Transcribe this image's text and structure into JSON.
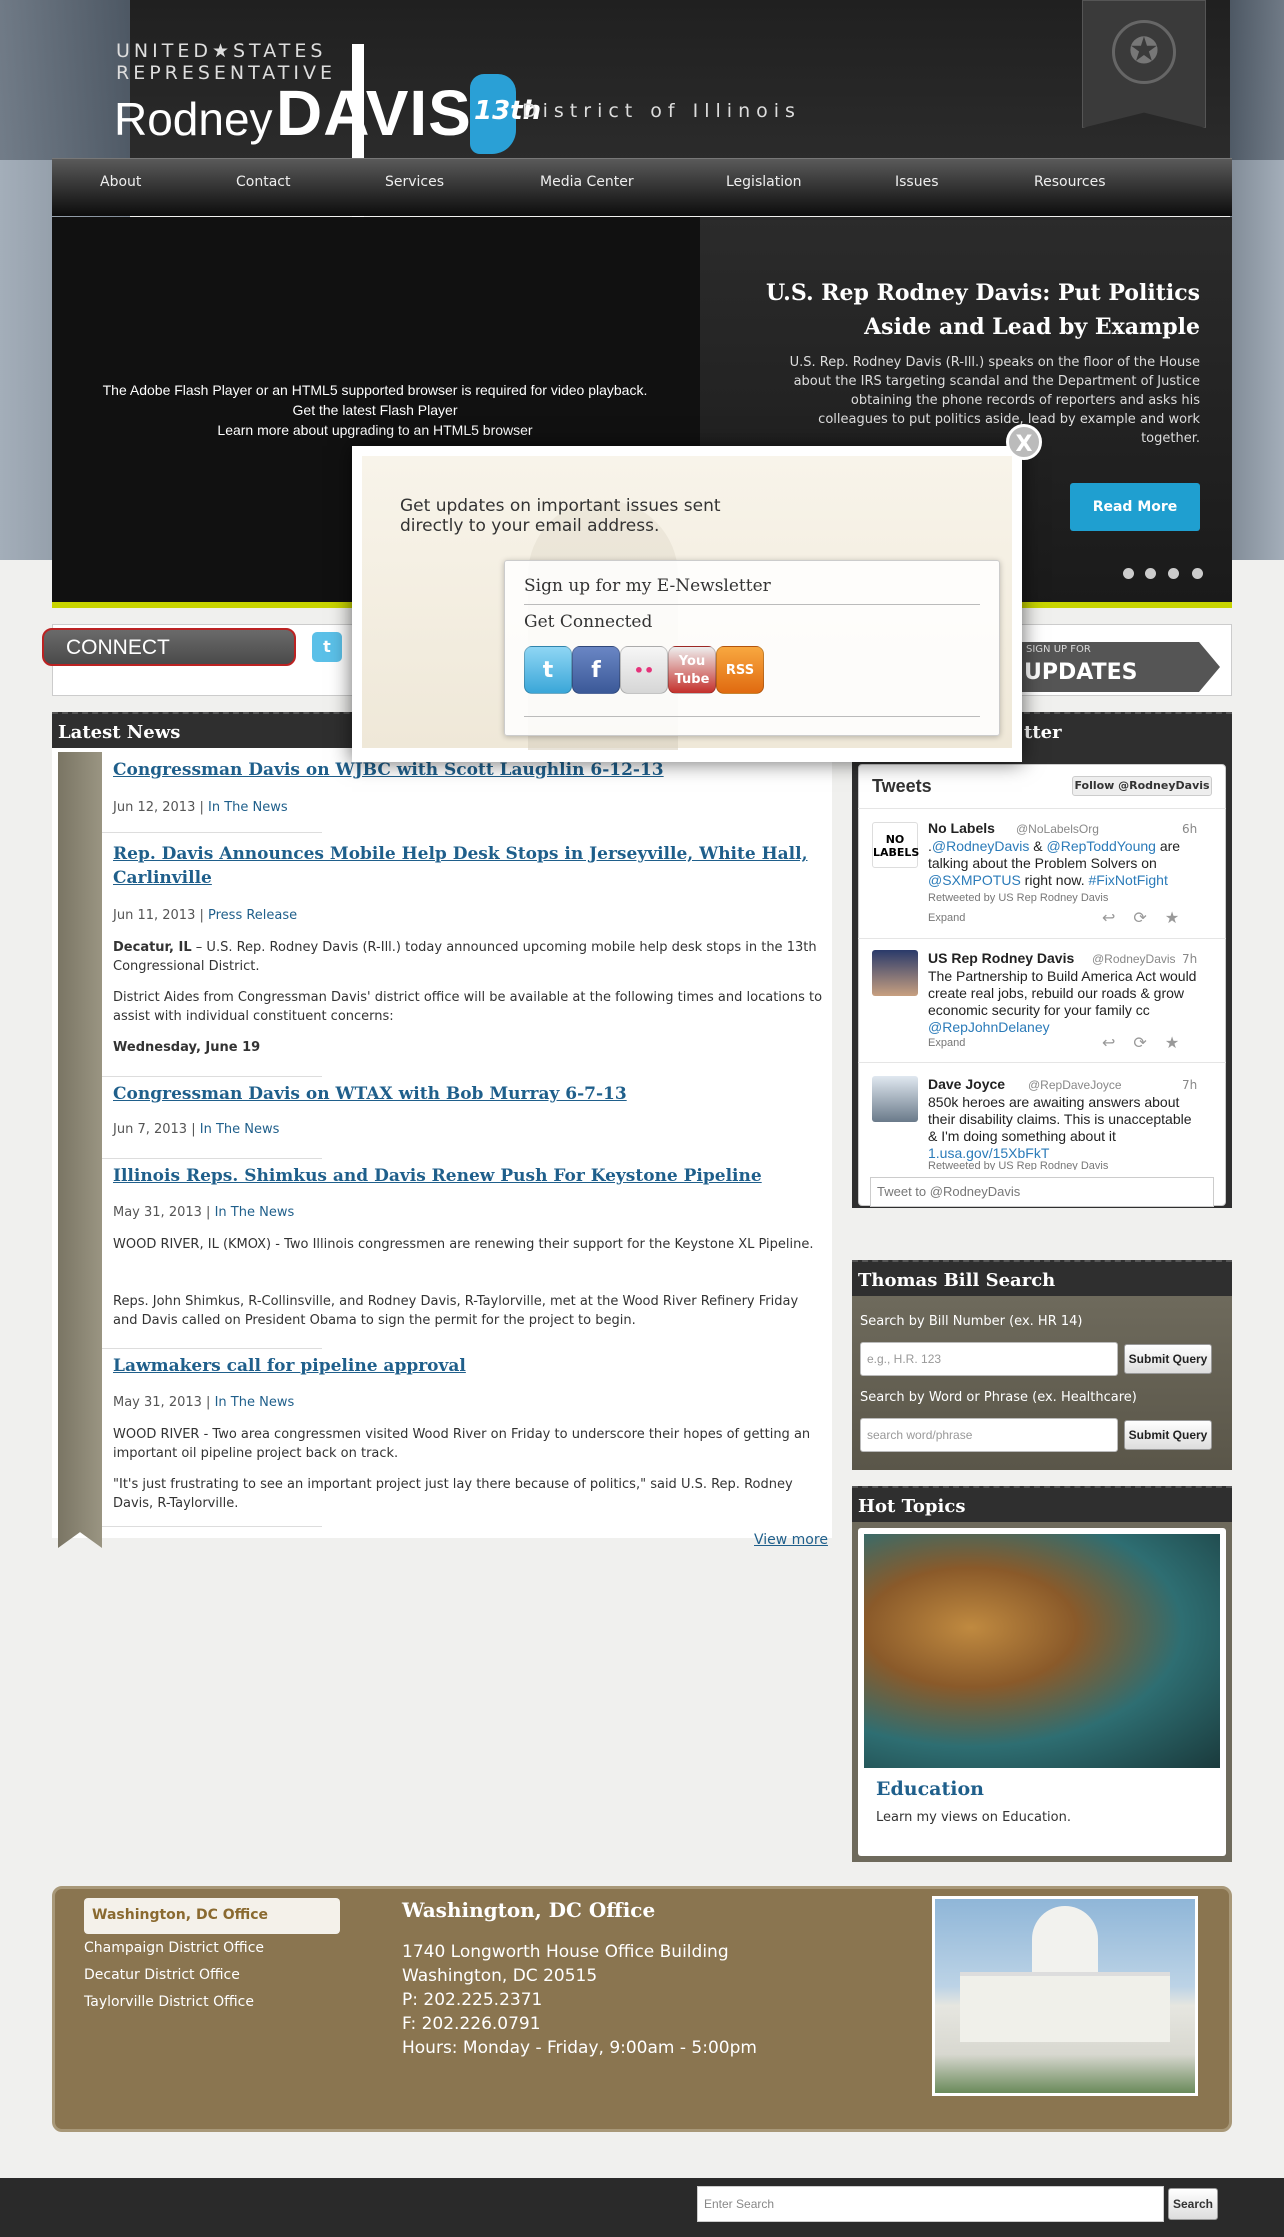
{
  "header": {
    "line1": "UNITED★STATES",
    "line2": "REPRESENTATIVE",
    "first_name": "Rodney",
    "last_name": "DAVIS",
    "district_num": "13th",
    "district_text": "District of Illinois"
  },
  "nav": [
    "About",
    "Contact",
    "Services",
    "Media Center",
    "Legislation",
    "Issues",
    "Resources"
  ],
  "hero": {
    "flash_message": "The Adobe Flash Player or an HTML5 supported browser is required for video playback.",
    "flash_link1": "Get the latest Flash Player",
    "flash_link2": "Learn more about upgrading to an HTML5 browser",
    "title": "U.S. Rep Rodney Davis: Put Politics Aside and Lead by Example",
    "text": "U.S. Rep. Rodney Davis (R-Ill.) speaks on the floor of the House about the IRS targeting scandal and the Department of Justice obtaining the phone records of reporters and asks his colleagues to put politics aside, lead by example and work together.",
    "read_more": "Read More"
  },
  "connect": {
    "label": "CONNECT",
    "updates_small": "SIGN UP FOR",
    "updates": "UPDATES"
  },
  "news": {
    "header": "Latest News",
    "items": [
      {
        "title": "Congressman Davis on WJBC with Scott Laughlin 6-12-13",
        "date": "Jun 12, 2013",
        "category": "In The News"
      },
      {
        "title": "Rep. Davis Announces Mobile Help Desk Stops in Jerseyville, White Hall, Carlinville",
        "date": "Jun 11, 2013",
        "category": "Press Release",
        "lead": "Decatur, IL",
        "text1": "– U.S. Rep. Rodney Davis (R-Ill.) today announced upcoming mobile help desk stops in the 13th Congressional District.",
        "text2": "District Aides from Congressman Davis' district office will be available at the following times and locations to assist with individual constituent concerns:",
        "text3": "Wednesday, June 19"
      },
      {
        "title": "Congressman Davis on WTAX with Bob Murray 6-7-13",
        "date": "Jun 7, 2013",
        "category": "In The News"
      },
      {
        "title": "Illinois Reps. Shimkus and Davis Renew Push For Keystone Pipeline",
        "date": "May 31, 2013",
        "category": "In The News",
        "text1": "WOOD RIVER, IL (KMOX) - Two Illinois congressmen are renewing their support for the Keystone XL Pipeline.",
        "text2": "Reps. John Shimkus, R-Collinsville, and Rodney Davis, R-Taylorville, met at the Wood River Refinery Friday and Davis called on President Obama to sign the permit for the project to begin."
      },
      {
        "title": "Lawmakers call for pipeline approval",
        "date": "May 31, 2013",
        "category": "In The News",
        "text1": "WOOD RIVER - Two area congressmen visited Wood River on Friday to underscore their hopes of getting an important oil pipeline project back on track.",
        "text2": "\"It's just frustrating to see an important project just lay there because of politics,\" said U.S. Rep. Rodney Davis, R-Taylorville."
      }
    ],
    "separator": "|",
    "view_more": "View more"
  },
  "newsletter_header": "tter",
  "twitter": {
    "title": "Tweets",
    "follow": "Follow @RodneyDavis",
    "input_placeholder": "Tweet to @RodneyDavis",
    "tweets": [
      {
        "name": "No Labels",
        "handle": "@NoLabelsOrg",
        "time": "6h",
        "avatar_text": "NO LABELS",
        "text_a": ".",
        "link1": "@RodneyDavis",
        "text_b": " & ",
        "link2": "@RepToddYoung",
        "text_c": " are talking about the Problem Solvers on ",
        "link3": "@SXMPOTUS",
        "text_d": " right now. ",
        "link4": "#FixNotFight",
        "retweet": "Retweeted by US Rep Rodney Davis",
        "expand": "Expand"
      },
      {
        "name": "US Rep Rodney Davis",
        "handle": "@RodneyDavis",
        "time": "7h",
        "text_a": "The Partnership to Build America Act would create real jobs, rebuild our roads & grow economic security for your family cc ",
        "link1": "@RepJohnDelaney",
        "expand": "Expand"
      },
      {
        "name": "Dave Joyce",
        "handle": "@RepDaveJoyce",
        "time": "7h",
        "text_a": "850k heroes are awaiting answers about their disability claims. This is unacceptable & I'm doing something about it ",
        "link1": "1.usa.gov/15XbFkT",
        "retweet": "Retweeted by US Rep Rodney Davis"
      }
    ],
    "actions": "↩⟳★"
  },
  "thomas": {
    "header": "Thomas Bill Search",
    "label1": "Search by Bill Number (ex. HR 14)",
    "placeholder1": "e.g., H.R. 123",
    "label2": "Search by Word or Phrase (ex. Healthcare)",
    "placeholder2": "search word/phrase",
    "button": "Submit Query"
  },
  "hot_topics": {
    "header": "Hot Topics",
    "title": "Education",
    "text": "Learn my views on Education."
  },
  "offices": {
    "tabs": [
      "Washington, DC Office",
      "Champaign District Office",
      "Decatur District Office",
      "Taylorville District Office"
    ],
    "title": "Washington, DC Office",
    "address1": "1740 Longworth House Office Building",
    "address2": "Washington, DC 20515",
    "phone": "P: 202.225.2371",
    "fax": "F: 202.226.0791",
    "hours": "Hours: Monday - Friday, 9:00am - 5:00pm"
  },
  "search": {
    "placeholder": "Enter Search",
    "button": "Search"
  },
  "modal": {
    "heading": "Get updates on important issues sent directly to your email address.",
    "signup": "Sign up for my E-Newsletter",
    "connected": "Get Connected",
    "close": "X",
    "social": [
      "t",
      "f",
      "••",
      "You Tube",
      "RSS"
    ]
  },
  "colors": {
    "accent_blue": "#1f9fd0",
    "link": "#1f5f8b",
    "office_bg": "#8a7550",
    "hero_stripe": "#c8d400"
  }
}
